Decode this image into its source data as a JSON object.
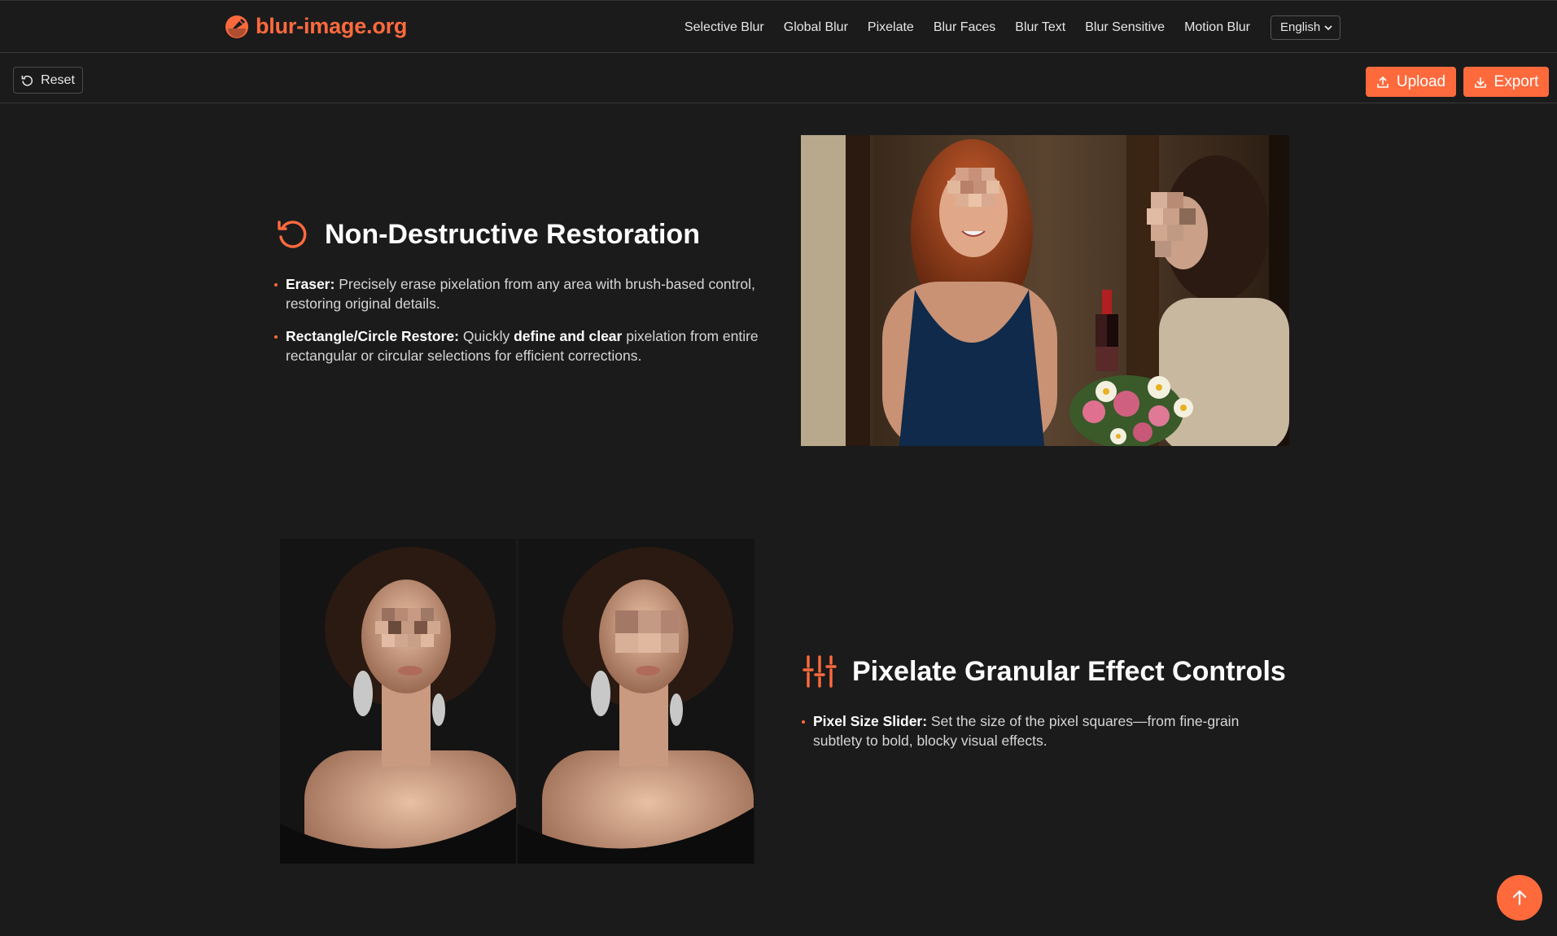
{
  "brand": {
    "name": "blur-image.org",
    "accent": "#ff6a3d"
  },
  "nav": {
    "links": [
      "Selective Blur",
      "Global Blur",
      "Pixelate",
      "Blur Faces",
      "Blur Text",
      "Blur Sensitive",
      "Motion Blur"
    ],
    "language": "English"
  },
  "toolbar": {
    "reset_label": "Reset",
    "upload_label": "Upload",
    "export_label": "Export"
  },
  "features": [
    {
      "icon": "restore-icon",
      "title": "Non-Destructive Restoration",
      "bullets": [
        {
          "bold": "Eraser:",
          "text": " Precisely erase pixelation from any area with brush-based control, restoring original details."
        },
        {
          "bold": "Rectangle/Circle Restore:",
          "text": " Quickly ",
          "bold2": "define and clear",
          "text2": " pixelation from entire rectangular or circular selections for efficient corrections."
        }
      ]
    },
    {
      "icon": "sliders-icon",
      "title": "Pixelate Granular Effect Controls",
      "bullets": [
        {
          "bold": "Pixel Size Slider:",
          "text": " Set the size of the pixel squares—from fine-grain subtlety to bold, blocky visual effects."
        }
      ]
    }
  ]
}
